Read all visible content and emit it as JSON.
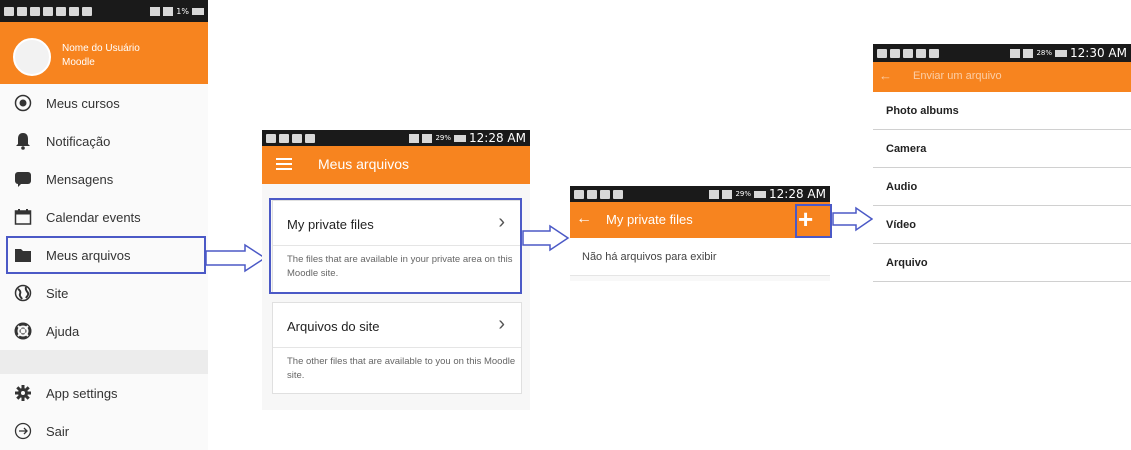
{
  "colors": {
    "accent": "#f7841f",
    "highlight": "#4b59c6"
  },
  "panel1": {
    "status_battery": "1%",
    "user_name": "Nome do Usuário",
    "user_site": "Moodle",
    "menu": [
      {
        "label": "Meus cursos",
        "icon": "radio-target-icon"
      },
      {
        "label": "Notificação",
        "icon": "bell-icon"
      },
      {
        "label": "Mensagens",
        "icon": "chat-bubble-icon"
      },
      {
        "label": "Calendar events",
        "icon": "calendar-icon"
      },
      {
        "label": "Meus arquivos",
        "icon": "folder-icon"
      },
      {
        "label": "Site",
        "icon": "globe-icon"
      },
      {
        "label": "Ajuda",
        "icon": "lifebuoy-icon"
      }
    ],
    "bottom_menu": [
      {
        "label": "App settings",
        "icon": "gear-icon"
      },
      {
        "label": "Sair",
        "icon": "logout-icon"
      }
    ]
  },
  "panel2": {
    "status_battery": "29%",
    "status_time": "12:28 AM",
    "title": "Meus arquivos",
    "cards": [
      {
        "title": "My private files",
        "desc": "The files that are available in your private area on this Moodle site."
      },
      {
        "title": "Arquivos do site",
        "desc": "The other files that are available to you on this Moodle site."
      }
    ]
  },
  "panel3": {
    "status_battery": "29%",
    "status_time": "12:28 AM",
    "title": "My private files",
    "empty": "Não há arquivos para exibir"
  },
  "panel4": {
    "status_battery": "28%",
    "status_time": "12:30 AM",
    "title": "Enviar um arquivo",
    "options": [
      "Photo albums",
      "Camera",
      "Audio",
      "Vídeo",
      "Arquivo"
    ]
  }
}
